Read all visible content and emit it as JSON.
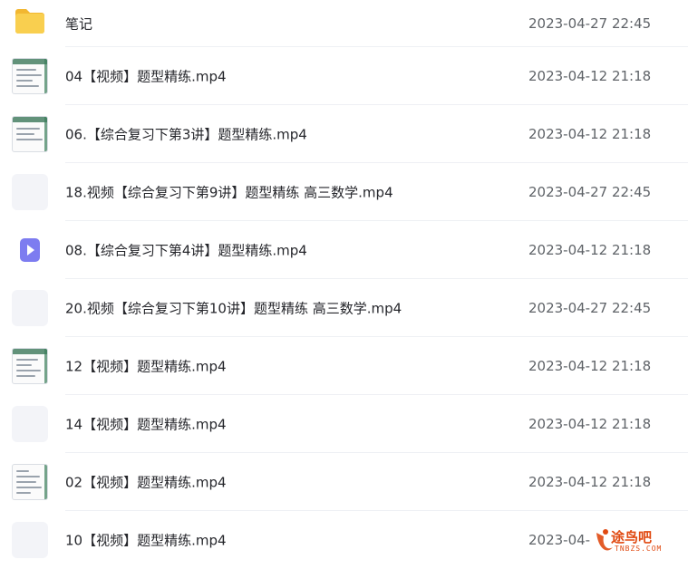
{
  "files": [
    {
      "type": "folder",
      "name": "笔记",
      "date": "2023-04-27 22:45"
    },
    {
      "type": "screenshot",
      "name": "04【视频】题型精练.mp4",
      "date": "2023-04-12 21:18"
    },
    {
      "type": "screenshot",
      "name": "06.【综合复习下第3讲】题型精练.mp4",
      "date": "2023-04-12 21:18"
    },
    {
      "type": "blank",
      "name": "18.视频【综合复习下第9讲】题型精练 高三数学.mp4",
      "date": "2023-04-27 22:45"
    },
    {
      "type": "video",
      "name": "08.【综合复习下第4讲】题型精练.mp4",
      "date": "2023-04-12 21:18"
    },
    {
      "type": "blank",
      "name": "20.视频【综合复习下第10讲】题型精练 高三数学.mp4",
      "date": "2023-04-27 22:45"
    },
    {
      "type": "screenshot",
      "name": "12【视频】题型精练.mp4",
      "date": "2023-04-12 21:18"
    },
    {
      "type": "blank",
      "name": "14【视频】题型精练.mp4",
      "date": "2023-04-12 21:18"
    },
    {
      "type": "screenshot",
      "name": "02【视频】题型精练.mp4",
      "date": "2023-04-12 21:18"
    },
    {
      "type": "blank",
      "name": "10【视频】题型精练.mp4",
      "date": "2023-04-"
    }
  ],
  "colors": {
    "folder": "#f7c842",
    "video": "#7d7cf0",
    "watermark": "#e04a12"
  },
  "watermark": {
    "text": "途鸟吧",
    "sub": "TNBZS.COM"
  }
}
